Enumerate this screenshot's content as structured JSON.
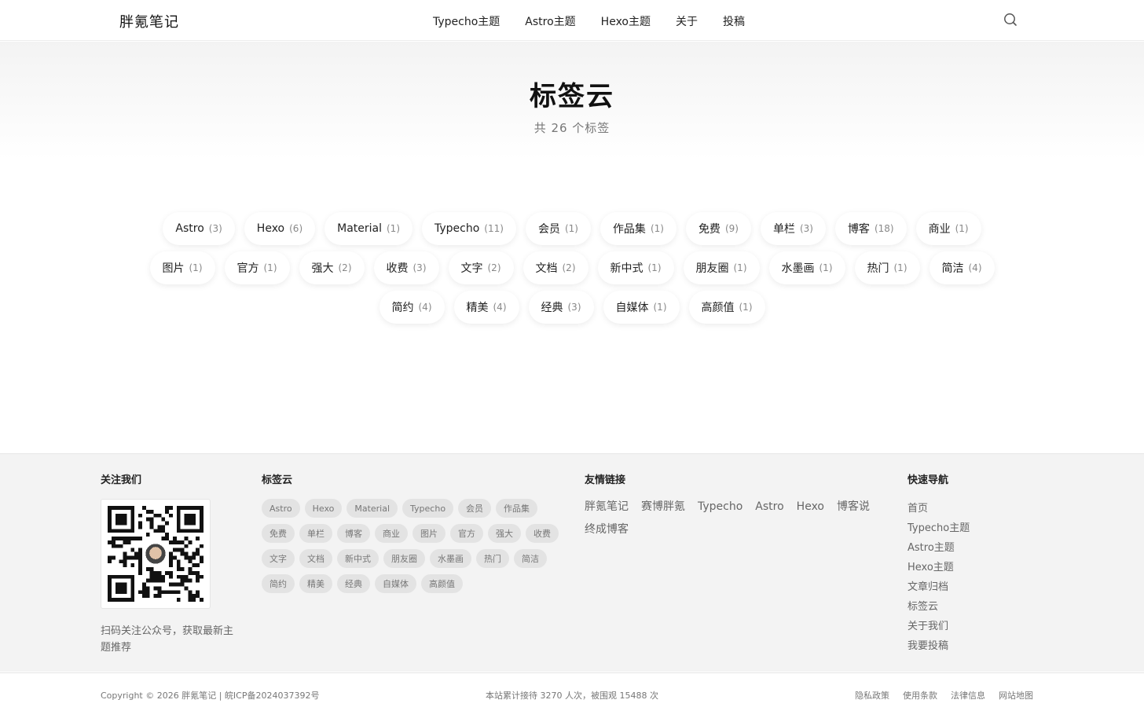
{
  "header": {
    "logo": "胖氪笔记",
    "nav": [
      "Typecho主题",
      "Astro主题",
      "Hexo主题",
      "关于",
      "投稿"
    ],
    "search_icon": "search-icon"
  },
  "hero": {
    "title": "标签云",
    "subtitle": "共 26 个标签"
  },
  "tags": [
    {
      "name": "Astro",
      "count": "(3)"
    },
    {
      "name": "Hexo",
      "count": "(6)"
    },
    {
      "name": "Material",
      "count": "(1)"
    },
    {
      "name": "Typecho",
      "count": "(11)"
    },
    {
      "name": "会员",
      "count": "(1)"
    },
    {
      "name": "作品集",
      "count": "(1)"
    },
    {
      "name": "免费",
      "count": "(9)"
    },
    {
      "name": "单栏",
      "count": "(3)"
    },
    {
      "name": "博客",
      "count": "(18)"
    },
    {
      "name": "商业",
      "count": "(1)"
    },
    {
      "name": "图片",
      "count": "(1)"
    },
    {
      "name": "官方",
      "count": "(1)"
    },
    {
      "name": "强大",
      "count": "(2)"
    },
    {
      "name": "收费",
      "count": "(3)"
    },
    {
      "name": "文字",
      "count": "(2)"
    },
    {
      "name": "文档",
      "count": "(2)"
    },
    {
      "name": "新中式",
      "count": "(1)"
    },
    {
      "name": "朋友圈",
      "count": "(1)"
    },
    {
      "name": "水墨画",
      "count": "(1)"
    },
    {
      "name": "热门",
      "count": "(1)"
    },
    {
      "name": "简洁",
      "count": "(4)"
    },
    {
      "name": "简约",
      "count": "(4)"
    },
    {
      "name": "精美",
      "count": "(4)"
    },
    {
      "name": "经典",
      "count": "(3)"
    },
    {
      "name": "自媒体",
      "count": "(1)"
    },
    {
      "name": "高颜值",
      "count": "(1)"
    }
  ],
  "footer": {
    "follow": {
      "title": "关注我们",
      "desc": "扫码关注公众号，获取最新主题推荐"
    },
    "tagcloud": {
      "title": "标签云",
      "tags": [
        "Astro",
        "Hexo",
        "Material",
        "Typecho",
        "会员",
        "作品集",
        "免费",
        "单栏",
        "博客",
        "商业",
        "图片",
        "官方",
        "强大",
        "收费",
        "文字",
        "文档",
        "新中式",
        "朋友圈",
        "水墨画",
        "热门",
        "简洁",
        "简约",
        "精美",
        "经典",
        "自媒体",
        "高颜值"
      ]
    },
    "links": {
      "title": "友情链接",
      "items": [
        "胖氪笔记",
        "赛博胖氪",
        "Typecho",
        "Astro",
        "Hexo",
        "博客说",
        "终成博客"
      ]
    },
    "quicknav": {
      "title": "快速导航",
      "items": [
        "首页",
        "Typecho主题",
        "Astro主题",
        "Hexo主题",
        "文章归档",
        "标签云",
        "关于我们",
        "我要投稿"
      ]
    }
  },
  "bottom": {
    "copyright": "Copyright © 2026 胖氪笔记  |  皖ICP备2024037392号",
    "stats": "本站累计接待 3270 人次，被围观 15488 次",
    "legal": [
      "隐私政策",
      "使用条款",
      "法律信息",
      "网站地图"
    ]
  }
}
